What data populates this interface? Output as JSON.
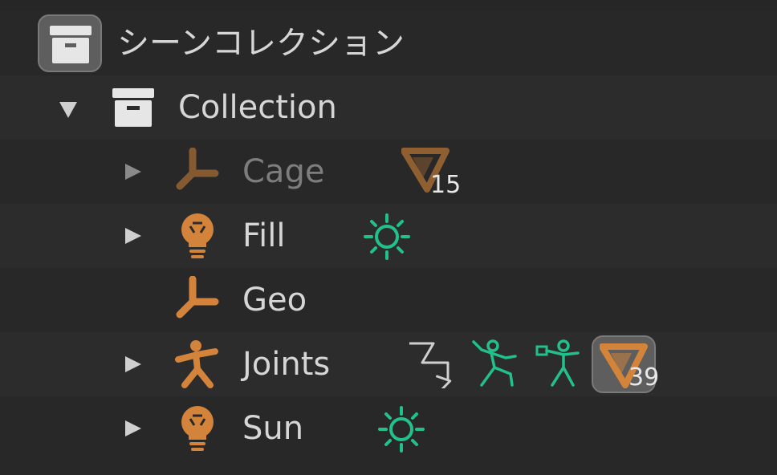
{
  "outliner": {
    "scene_collection_label": "シーンコレクション",
    "collection": {
      "label": "Collection",
      "expanded": true
    },
    "objects": [
      {
        "name": "Cage",
        "type_icon": "armature-data-icon",
        "dimmed": true,
        "has_expander": true,
        "modifiers": [
          {
            "icon": "vertex-group-icon",
            "count": "15"
          }
        ]
      },
      {
        "name": "Fill",
        "type_icon": "light-bulb-icon",
        "dimmed": false,
        "has_expander": true,
        "modifiers": [
          {
            "icon": "sun-light-icon"
          }
        ]
      },
      {
        "name": "Geo",
        "type_icon": "armature-data-icon",
        "dimmed": false,
        "has_expander": false,
        "modifiers": []
      },
      {
        "name": "Joints",
        "type_icon": "armature-object-icon",
        "dimmed": false,
        "has_expander": true,
        "modifiers": [
          {
            "icon": "parent-arrow-icon"
          },
          {
            "icon": "pose-running-icon"
          },
          {
            "icon": "pose-armature-data-icon"
          },
          {
            "icon": "vertex-group-icon",
            "count": "39",
            "highlighted": true
          }
        ]
      },
      {
        "name": "Sun",
        "type_icon": "light-bulb-icon",
        "dimmed": false,
        "has_expander": true,
        "modifiers": [
          {
            "icon": "sun-light-icon"
          }
        ]
      }
    ]
  },
  "colors": {
    "orange": "#d4843a",
    "green": "#22c08a",
    "text": "#d6d6d6",
    "dim_text": "#7d7d7d"
  }
}
